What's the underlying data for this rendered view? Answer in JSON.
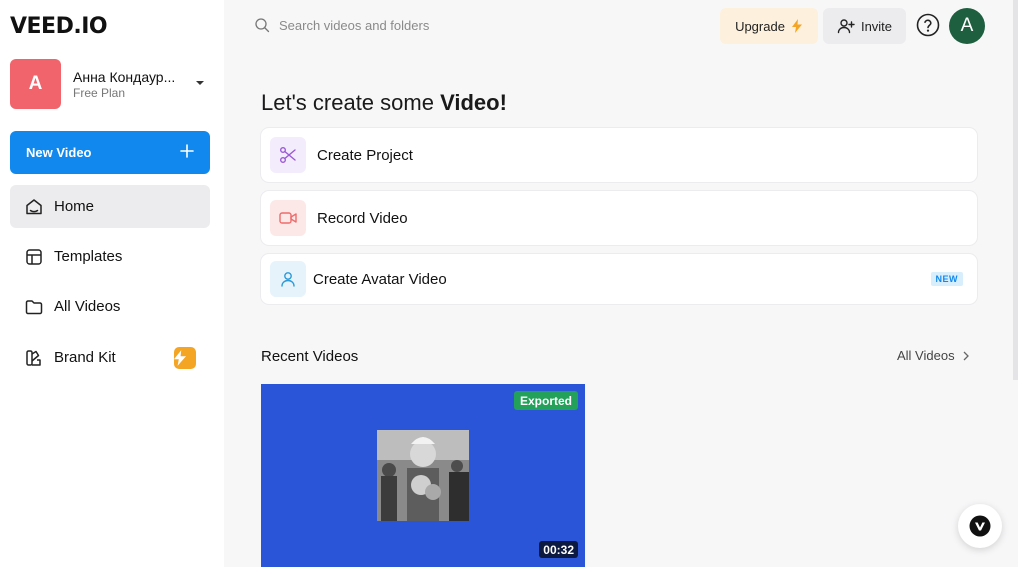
{
  "brand": {
    "logo_text": "VEED.IO"
  },
  "account": {
    "initial": "A",
    "name": "Анна Кондаур...",
    "plan": "Free Plan"
  },
  "sidebar": {
    "new_video_label": "New Video",
    "items": [
      {
        "label": "Home",
        "icon": "home-icon",
        "active": true
      },
      {
        "label": "Templates",
        "icon": "templates-icon",
        "active": false
      },
      {
        "label": "All Videos",
        "icon": "folder-icon",
        "active": false
      },
      {
        "label": "Brand Kit",
        "icon": "brand-kit-icon",
        "active": false,
        "badge_icon": "bolt-icon"
      }
    ]
  },
  "topbar": {
    "search_placeholder": "Search videos and folders",
    "upgrade_label": "Upgrade",
    "invite_label": "Invite",
    "user_initial": "A"
  },
  "main": {
    "heading_prefix": "Let's create some ",
    "heading_bold": "Video!",
    "actions": [
      {
        "label": "Create Project",
        "icon": "scissors-icon",
        "icon_bg": "#f3ecfc",
        "icon_color": "#9b59d6"
      },
      {
        "label": "Record Video",
        "icon": "record-icon",
        "icon_bg": "#fde8e8",
        "icon_color": "#ee6b6b"
      },
      {
        "label": "Create Avatar Video",
        "icon": "avatar-user-icon",
        "icon_bg": "#e6f3fb",
        "icon_color": "#2a9ad8",
        "tag": "NEW"
      }
    ],
    "recent_title": "Recent Videos",
    "all_videos_link": "All Videos",
    "videos": [
      {
        "status": "Exported",
        "duration": "00:32"
      }
    ]
  },
  "colors": {
    "accent": "#1188ee",
    "avatar_bg": "#f2646c",
    "video_card_bg": "#2b55d8",
    "exported_badge": "#23a05a",
    "upgrade_bg": "#fdf0dc"
  }
}
